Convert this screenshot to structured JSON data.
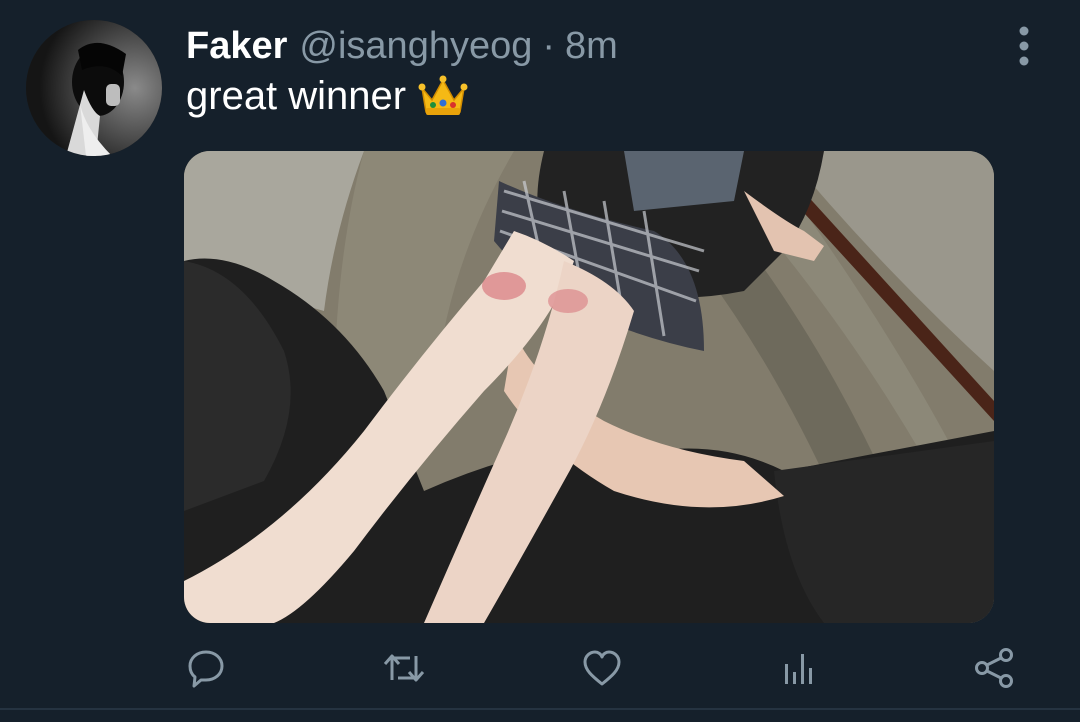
{
  "tweet": {
    "display_name": "Faker",
    "handle": "@isanghyeog",
    "separator": "·",
    "time": "8m",
    "text": "great winner",
    "emoji": "crown-emoji"
  },
  "actions": [
    {
      "name": "reply",
      "icon": "reply-icon"
    },
    {
      "name": "retweet",
      "icon": "retweet-icon"
    },
    {
      "name": "like",
      "icon": "heart-icon"
    },
    {
      "name": "analytics",
      "icon": "analytics-icon"
    },
    {
      "name": "share",
      "icon": "share-icon"
    }
  ],
  "colors": {
    "background": "#15202b",
    "text_primary": "#ffffff",
    "text_secondary": "#8899a6",
    "icon": "#8899a6"
  }
}
